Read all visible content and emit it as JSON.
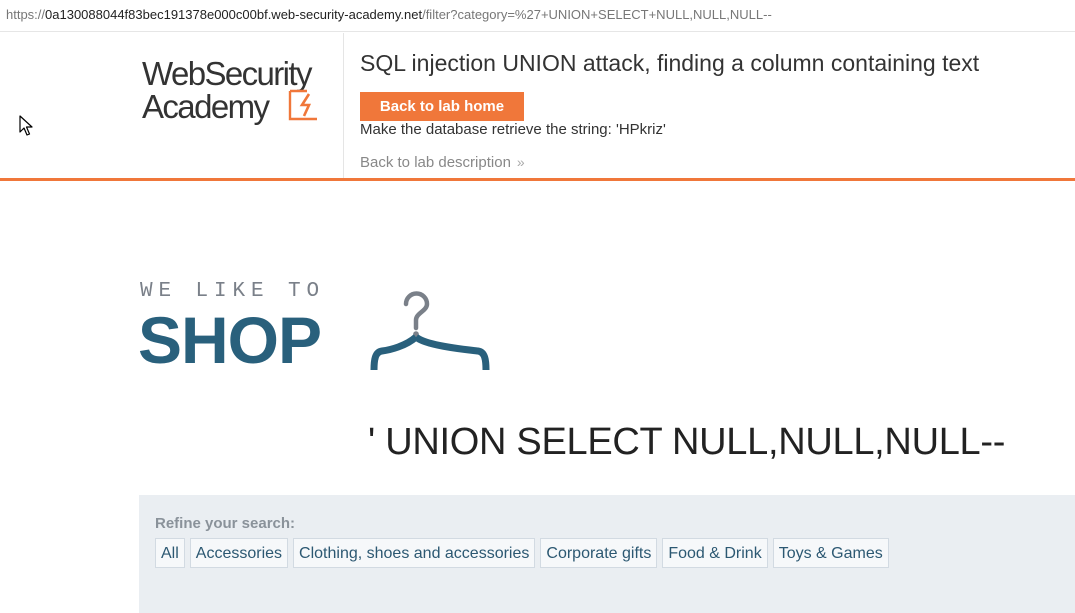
{
  "browser": {
    "url_scheme": "https://",
    "url_host": "0a130088044f83bec191378e000c00bf.web-security-academy.net",
    "url_path": "/filter?category=%27+UNION+SELECT+NULL,NULL,NULL--"
  },
  "academy_header": {
    "logo_line1": "WebSecurity",
    "logo_line2": "Academy",
    "lab_title": "SQL injection UNION attack, finding a column containing text",
    "back_home_label": "Back to lab home",
    "objective": "Make the database retrieve the string: 'HPkriz'",
    "back_description_label": "Back to lab description",
    "back_description_chevron": "»",
    "accent_color": "#f0773a"
  },
  "shop": {
    "tagline": "WE LIKE TO",
    "brand": "SHOP",
    "brand_color": "#29607c"
  },
  "search": {
    "heading": "' UNION SELECT NULL,NULL,NULL--"
  },
  "filters": {
    "label": "Refine your search:",
    "categories": [
      "All",
      "Accessories",
      "Clothing, shoes and accessories",
      "Corporate gifts",
      "Food & Drink",
      "Toys & Games"
    ]
  },
  "icons": {
    "cursor": "mouse-pointer-icon",
    "logo_mark": "lightning-bolt-icon",
    "shop_mark": "clothes-hanger-icon"
  }
}
